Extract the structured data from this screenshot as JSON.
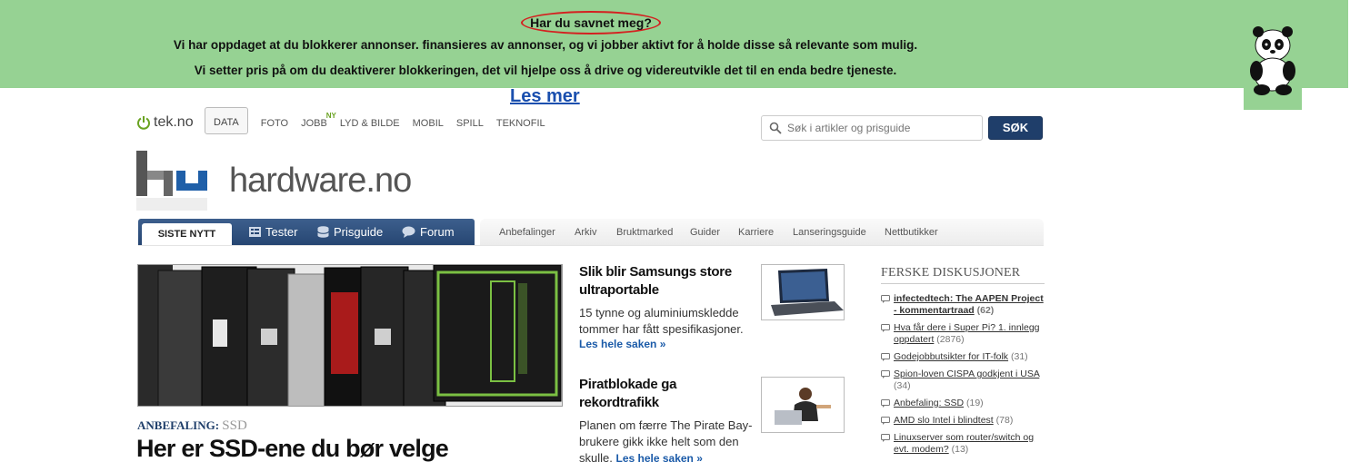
{
  "banner": {
    "title": "Har du savnet meg?",
    "line1": "Vi har oppdaget at du blokkerer annonser. finansieres av annonser, og vi jobber aktivt for å holde disse så relevante som mulig.",
    "line2": "Vi setter pris på om du deaktiverer blokkeringen, det vil hjelpe oss å drive og videreutvikle det til en enda bedre tjeneste.",
    "link": "Les mer",
    "bg_color": "#96d293",
    "mascot_icon": "panda-icon"
  },
  "header": {
    "brand": "tek.no",
    "nav": [
      {
        "label": "DATA",
        "active": true
      },
      {
        "label": "FOTO"
      },
      {
        "label": "JOBB",
        "badge": "NY"
      },
      {
        "label": "LYD & BILDE"
      },
      {
        "label": "MOBIL"
      },
      {
        "label": "SPILL"
      },
      {
        "label": "TEKNOFIL"
      }
    ],
    "search_placeholder": "Søk i artikler og prisguide",
    "search_button": "SØK"
  },
  "site": {
    "name": "hardware.no"
  },
  "sections": {
    "tabs": [
      {
        "label": "SISTE NYTT",
        "active": true
      },
      {
        "label": "Tester",
        "icon": "tester-icon"
      },
      {
        "label": "Prisguide",
        "icon": "database-icon"
      },
      {
        "label": "Forum",
        "icon": "chat-bubble-icon"
      }
    ],
    "links": [
      "Anbefalinger",
      "Arkiv",
      "Bruktmarked",
      "Guider",
      "Karriere",
      "Lanseringsguide",
      "Nettbutikker"
    ]
  },
  "feature": {
    "category": "ANBEFALING:",
    "subcategory": "SSD",
    "headline": "Her er SSD-ene du bør velge"
  },
  "articles": [
    {
      "title": "Slik blir Samsungs store ultraportable",
      "desc": "15 tynne og aluminiumskledde tommer har fått spesifikasjoner.",
      "more": "Les hele saken »"
    },
    {
      "title": "Piratblokade ga rekordtrafikk",
      "desc": "Planen om færre The Pirate Bay-brukere gikk ikke helt som den skulle.",
      "more": "Les hele saken »"
    }
  ],
  "forum": {
    "heading": "FERSKE DISKUSJONER",
    "items": [
      {
        "title": "infectedtech: The AAPEN Project - kommentartraad",
        "count": "(62)",
        "bold": true
      },
      {
        "title": "Hva får dere i Super Pi? 1. innlegg oppdatert",
        "count": "(2876)"
      },
      {
        "title": "Godejobbutsikter for IT-folk",
        "count": "(31)"
      },
      {
        "title": "Spion-loven CISPA godkjent i USA",
        "count": "(34)"
      },
      {
        "title": "Anbefaling: SSD",
        "count": "(19)"
      },
      {
        "title": "AMD slo Intel i blindtest",
        "count": "(78)"
      },
      {
        "title": "Linuxserver som router/switch og evt. modem?",
        "count": "(13)"
      }
    ]
  }
}
